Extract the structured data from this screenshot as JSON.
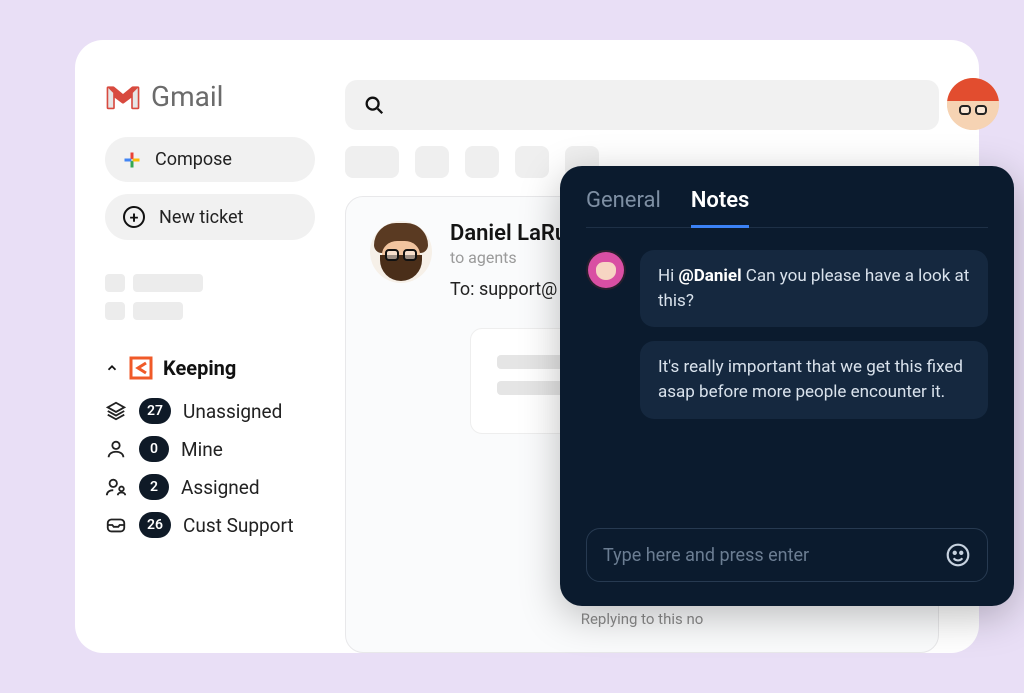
{
  "header": {
    "app_name": "Gmail"
  },
  "sidebar": {
    "compose_label": "Compose",
    "new_ticket_label": "New ticket",
    "keeping_label": "Keeping",
    "items": [
      {
        "count": "27",
        "label": "Unassigned"
      },
      {
        "count": "0",
        "label": "Mine"
      },
      {
        "count": "2",
        "label": "Assigned"
      },
      {
        "count": "26",
        "label": "Cust Support"
      }
    ]
  },
  "email": {
    "sender_name": "Daniel LaRu",
    "subline": "to agents",
    "to_line": "To: support@",
    "footer": "Replying to this no"
  },
  "notes": {
    "tabs": {
      "general": "General",
      "notes": "Notes"
    },
    "messages": [
      {
        "prefix": "Hi ",
        "mention": "@Daniel",
        "rest": " Can you please have a look at this?"
      },
      {
        "text": "It's really important that we get this fixed asap before more people encounter it."
      }
    ],
    "input_placeholder": "Type here and press enter"
  }
}
